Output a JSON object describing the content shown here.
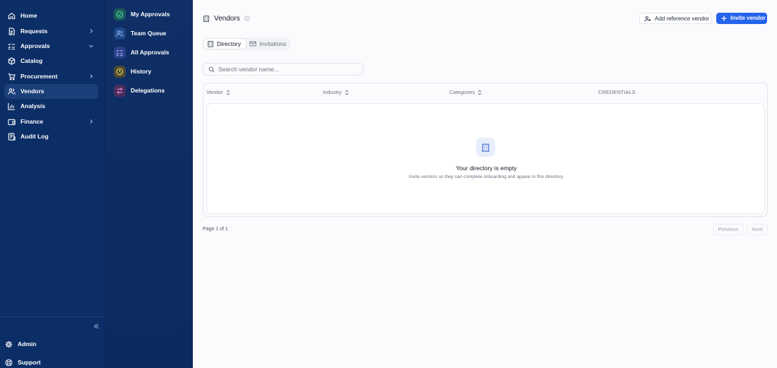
{
  "sidebar": {
    "items": [
      {
        "label": "Home",
        "icon": "home-icon"
      },
      {
        "label": "Requests",
        "icon": "file-icon"
      },
      {
        "label": "Approvals",
        "icon": "checklist-icon"
      },
      {
        "label": "Catalog",
        "icon": "box-icon"
      },
      {
        "label": "Procurement",
        "icon": "cart-icon"
      },
      {
        "label": "Vendors",
        "icon": "users-icon"
      },
      {
        "label": "Analysis",
        "icon": "bar-chart-icon"
      },
      {
        "label": "Finance",
        "icon": "wallet-icon"
      },
      {
        "label": "Audit Log",
        "icon": "log-icon"
      }
    ],
    "footer": [
      {
        "label": "Admin",
        "icon": "gear-icon"
      },
      {
        "label": "Support",
        "icon": "lifebuoy-icon"
      }
    ]
  },
  "subnav": {
    "items": [
      {
        "label": "My Approvals",
        "icon": "check-circle-icon"
      },
      {
        "label": "Team Queue",
        "icon": "team-icon"
      },
      {
        "label": "All Approvals",
        "icon": "list-check-icon"
      },
      {
        "label": "History",
        "icon": "clock-icon"
      },
      {
        "label": "Delegations",
        "icon": "swap-icon"
      }
    ]
  },
  "header": {
    "title": "Vendors",
    "add_reference_label": "Add reference vendor",
    "invite_label": "Invite vendor"
  },
  "tabs": [
    {
      "label": "Directory",
      "active": true
    },
    {
      "label": "Invitations",
      "active": false
    }
  ],
  "search": {
    "placeholder": "Search vendor name...",
    "value": ""
  },
  "table": {
    "columns": [
      "Vendor",
      "Industry",
      "Categories",
      "CREDENTIALS"
    ],
    "rows": [],
    "empty_title": "Your directory is empty",
    "empty_subtitle": "Invite vendors so they can complete onboarding and appear in this directory."
  },
  "pagination": {
    "info": "Page 1 of 1",
    "previous_label": "Previous",
    "next_label": "Next"
  },
  "colors": {
    "sidebar_bg": "#0b2e66",
    "accent": "#2563eb",
    "page_bg": "#fbfbfd"
  }
}
